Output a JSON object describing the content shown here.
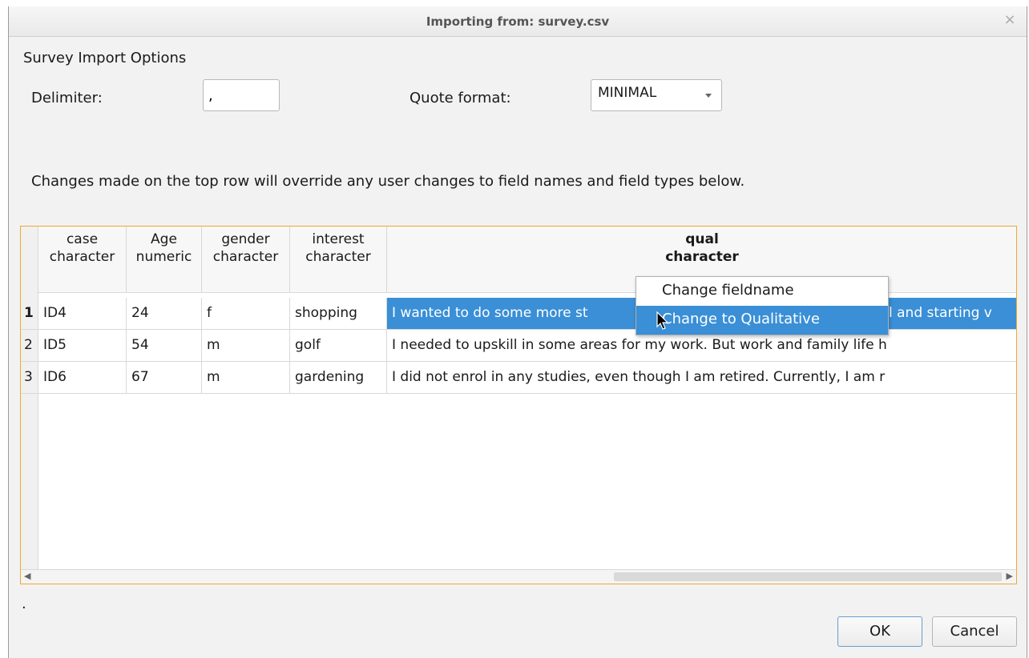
{
  "window": {
    "title": "Importing from: survey.csv",
    "close_glyph": "×"
  },
  "options": {
    "section_title": "Survey Import Options",
    "delimiter_label": "Delimiter:",
    "delimiter_value": ",",
    "quote_label": "Quote format:",
    "quote_value": "MINIMAL"
  },
  "note": "Changes made on the top row will override any user changes to field names and field types below.",
  "table": {
    "columns": [
      {
        "name": "case",
        "type": "character"
      },
      {
        "name": "Age",
        "type": "numeric"
      },
      {
        "name": "gender",
        "type": "character"
      },
      {
        "name": "interest",
        "type": "character"
      },
      {
        "name": "qual",
        "type": "character"
      }
    ],
    "rows": [
      {
        "num": "1",
        "cells": [
          "ID4",
          "24",
          "f",
          "shopping",
          "I wanted to do some more st",
          "l and starting v"
        ]
      },
      {
        "num": "2",
        "cells": [
          "ID5",
          "54",
          "m",
          "golf",
          "I needed to upskill in some areas for my work. But work and family life h"
        ]
      },
      {
        "num": "3",
        "cells": [
          "ID6",
          "67",
          "m",
          "gardening",
          "I did not enrol in any studies, even though I am retired. Currently, I am r"
        ]
      }
    ]
  },
  "context_menu": {
    "items": [
      "Change fieldname",
      "Change to Qualitative"
    ]
  },
  "status_text": ".",
  "buttons": {
    "ok": "OK",
    "cancel": "Cancel"
  }
}
